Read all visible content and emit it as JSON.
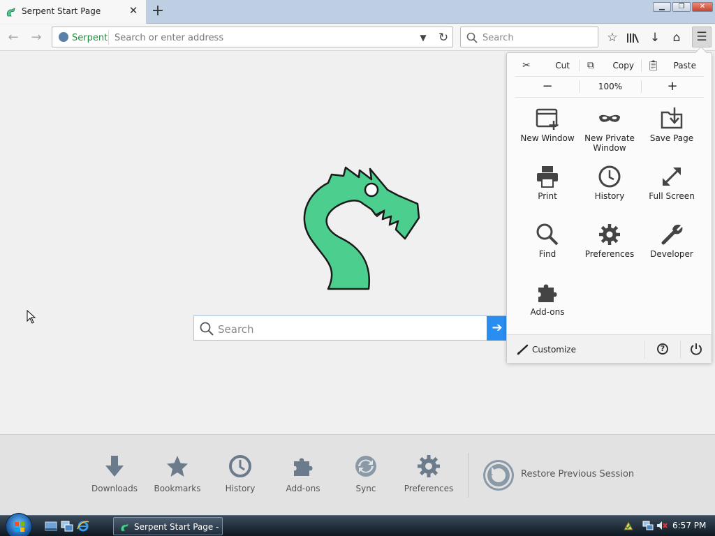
{
  "browser": {
    "tab": {
      "title": "Serpent Start Page"
    },
    "window_buttons": {
      "minimize": "▁",
      "maximize": "❐",
      "close": "✕"
    },
    "urlbar": {
      "site_name": "Serpent",
      "placeholder": "Search or enter address"
    },
    "searchbar": {
      "placeholder": "Search"
    }
  },
  "page": {
    "search_placeholder": "Search",
    "launcher": [
      {
        "label": "Downloads",
        "icon": "download-arrow-icon"
      },
      {
        "label": "Bookmarks",
        "icon": "star-icon"
      },
      {
        "label": "History",
        "icon": "clock-icon"
      },
      {
        "label": "Add-ons",
        "icon": "puzzle-icon"
      },
      {
        "label": "Sync",
        "icon": "sync-icon"
      },
      {
        "label": "Preferences",
        "icon": "gear-icon"
      }
    ],
    "restore_session": "Restore Previous Session"
  },
  "menu_panel": {
    "edit": {
      "cut": "Cut",
      "copy": "Copy",
      "paste": "Paste"
    },
    "zoom": {
      "out": "−",
      "level": "100%",
      "in": "+"
    },
    "items": [
      {
        "label": "New Window",
        "icon": "new-window-icon"
      },
      {
        "label": "New Private Window",
        "icon": "mask-icon"
      },
      {
        "label": "Save Page",
        "icon": "save-page-icon"
      },
      {
        "label": "Print",
        "icon": "printer-icon"
      },
      {
        "label": "History",
        "icon": "clock-icon"
      },
      {
        "label": "Full Screen",
        "icon": "fullscreen-icon"
      },
      {
        "label": "Find",
        "icon": "magnifier-icon"
      },
      {
        "label": "Preferences",
        "icon": "gear-icon"
      },
      {
        "label": "Developer",
        "icon": "wrench-icon"
      },
      {
        "label": "Add-ons",
        "icon": "puzzle-icon"
      }
    ],
    "footer": {
      "customize": "Customize",
      "help": "?"
    }
  },
  "taskbar": {
    "task_title": "Serpent Start Page - ...",
    "clock": "6:57 PM"
  },
  "colors": {
    "accent": "#2a8ef0",
    "logo_fill": "#4ccf8e",
    "site_green": "#1a8f3a"
  }
}
